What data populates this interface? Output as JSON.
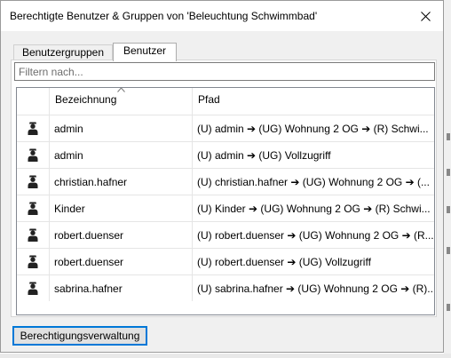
{
  "dialog": {
    "title": "Berechtigte Benutzer & Gruppen von 'Beleuchtung Schwimmbad'"
  },
  "tabs": [
    {
      "label": "Benutzergruppen",
      "active": false
    },
    {
      "label": "Benutzer",
      "active": true
    }
  ],
  "filter": {
    "placeholder": "Filtern nach...",
    "value": ""
  },
  "table": {
    "columns": [
      "Bezeichnung",
      "Pfad"
    ],
    "sort": {
      "column": "Bezeichnung",
      "direction": "ascending"
    },
    "rows": [
      {
        "icon": "user-icon",
        "name": "admin",
        "path": "(U) admin ➔ (UG) Wohnung 2 OG ➔ (R) Schwi..."
      },
      {
        "icon": "user-icon",
        "name": "admin",
        "path": "(U) admin ➔ (UG) Vollzugriff"
      },
      {
        "icon": "user-icon",
        "name": "christian.hafner",
        "path": "(U) christian.hafner ➔ (UG) Wohnung 2 OG ➔ (..."
      },
      {
        "icon": "user-icon",
        "name": "Kinder",
        "path": "(U) Kinder ➔ (UG) Wohnung 2 OG ➔ (R) Schwi..."
      },
      {
        "icon": "user-icon",
        "name": "robert.duenser",
        "path": "(U) robert.duenser ➔ (UG) Wohnung 2 OG ➔ (R..."
      },
      {
        "icon": "user-icon",
        "name": "robert.duenser",
        "path": "(U) robert.duenser ➔ (UG) Vollzugriff"
      },
      {
        "icon": "user-icon",
        "name": "sabrina.hafner",
        "path": "(U) sabrina.hafner ➔ (UG) Wohnung 2 OG ➔ (R)..."
      }
    ]
  },
  "buttons": {
    "permission_management": "Berechtigungsverwaltung"
  },
  "colors": {
    "accent": "#0078d7",
    "dialog_bg": "#f0f0f0"
  }
}
